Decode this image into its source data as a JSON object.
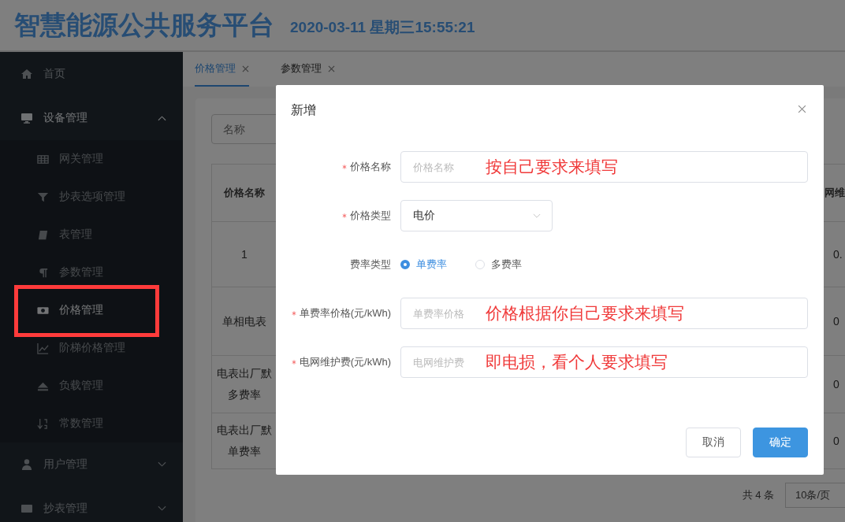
{
  "header": {
    "title": "智慧能源公共服务平台",
    "datetime": "2020-03-11 星期三15:55:21"
  },
  "sidebar": {
    "items": [
      {
        "label": "首页"
      },
      {
        "label": "设备管理",
        "expanded": true,
        "children": [
          {
            "label": "网关管理",
            "selected": false,
            "highlighted": false
          },
          {
            "label": "抄表选项管理",
            "selected": false,
            "highlighted": false
          },
          {
            "label": "表管理",
            "selected": false,
            "highlighted": false
          },
          {
            "label": "参数管理",
            "selected": false,
            "highlighted": false
          },
          {
            "label": "价格管理",
            "selected": true,
            "highlighted": true
          },
          {
            "label": "阶梯价格管理",
            "selected": false,
            "highlighted": false
          },
          {
            "label": "负载管理",
            "selected": false,
            "highlighted": false
          },
          {
            "label": "常数管理",
            "selected": false,
            "highlighted": false
          }
        ]
      },
      {
        "label": "用户管理",
        "expanded": false
      },
      {
        "label": "抄表管理",
        "expanded": false
      }
    ]
  },
  "tabs": [
    {
      "label": "价格管理",
      "selected": true
    },
    {
      "label": "参数管理",
      "selected": false
    }
  ],
  "search": {
    "placeholder": "名称"
  },
  "table": {
    "columns": [
      "价格名称",
      "网维"
    ],
    "rows": [
      [
        "1",
        "0."
      ],
      [
        "单相电表",
        "0"
      ],
      [
        "电表出厂默多费率",
        "0"
      ],
      [
        "电表出厂默单费率",
        "0"
      ]
    ]
  },
  "pagination": {
    "total": "共 4 条",
    "page_size": "10条/页"
  },
  "dialog": {
    "title": "新增",
    "fields": [
      {
        "kind": "text",
        "label": "价格名称",
        "required": true,
        "placeholder": "价格名称",
        "note": "按自己要求来填写"
      },
      {
        "kind": "select",
        "label": "价格类型",
        "required": true,
        "value": "电价"
      },
      {
        "kind": "radio",
        "label": "费率类型",
        "required": false,
        "options": [
          {
            "label": "单费率",
            "selected": true
          },
          {
            "label": "多费率",
            "selected": false
          }
        ]
      },
      {
        "kind": "text",
        "label": "单费率价格(元/kWh)",
        "required": true,
        "placeholder": "单费率价格",
        "note": "价格根据你自己要求来填写"
      },
      {
        "kind": "text",
        "label": "电网维护费(元/kWh)",
        "required": true,
        "placeholder": "电网维护费",
        "note": "即电损，看个人要求填写"
      }
    ],
    "buttons": [
      {
        "label": "取消",
        "primary": false
      },
      {
        "label": "确定",
        "primary": true
      }
    ]
  }
}
